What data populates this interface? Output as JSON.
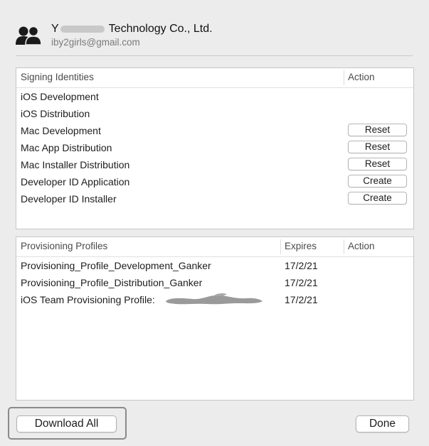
{
  "account": {
    "team_name_prefix": "Y",
    "team_name_suffix": "Technology Co., Ltd.",
    "email": "iby2girls@gmail.com",
    "icon": "team-members-icon"
  },
  "signing_identities": {
    "column_headers": [
      "Signing Identities",
      "Action"
    ],
    "rows": [
      {
        "name": "iOS Development",
        "action": ""
      },
      {
        "name": "iOS Distribution",
        "action": ""
      },
      {
        "name": "Mac Development",
        "action": "Reset"
      },
      {
        "name": "Mac App Distribution",
        "action": "Reset"
      },
      {
        "name": "Mac Installer Distribution",
        "action": "Reset"
      },
      {
        "name": "Developer ID Application",
        "action": "Create"
      },
      {
        "name": "Developer ID Installer",
        "action": "Create"
      }
    ]
  },
  "provisioning_profiles": {
    "column_headers": [
      "Provisioning Profiles",
      "Expires",
      "Action"
    ],
    "rows": [
      {
        "name": "Provisioning_Profile_Development_Ganker",
        "expires": "17/2/21"
      },
      {
        "name": "Provisioning_Profile_Distribution_Ganker",
        "expires": "17/2/21"
      },
      {
        "name": "iOS Team Provisioning Profile: ",
        "expires": "17/2/21",
        "redacted": true
      }
    ]
  },
  "buttons": {
    "download_all": "Download All",
    "done": "Done"
  },
  "colors": {
    "background": "#ececec",
    "panel": "#ffffff",
    "highlight_border": "#8a8a8a"
  }
}
